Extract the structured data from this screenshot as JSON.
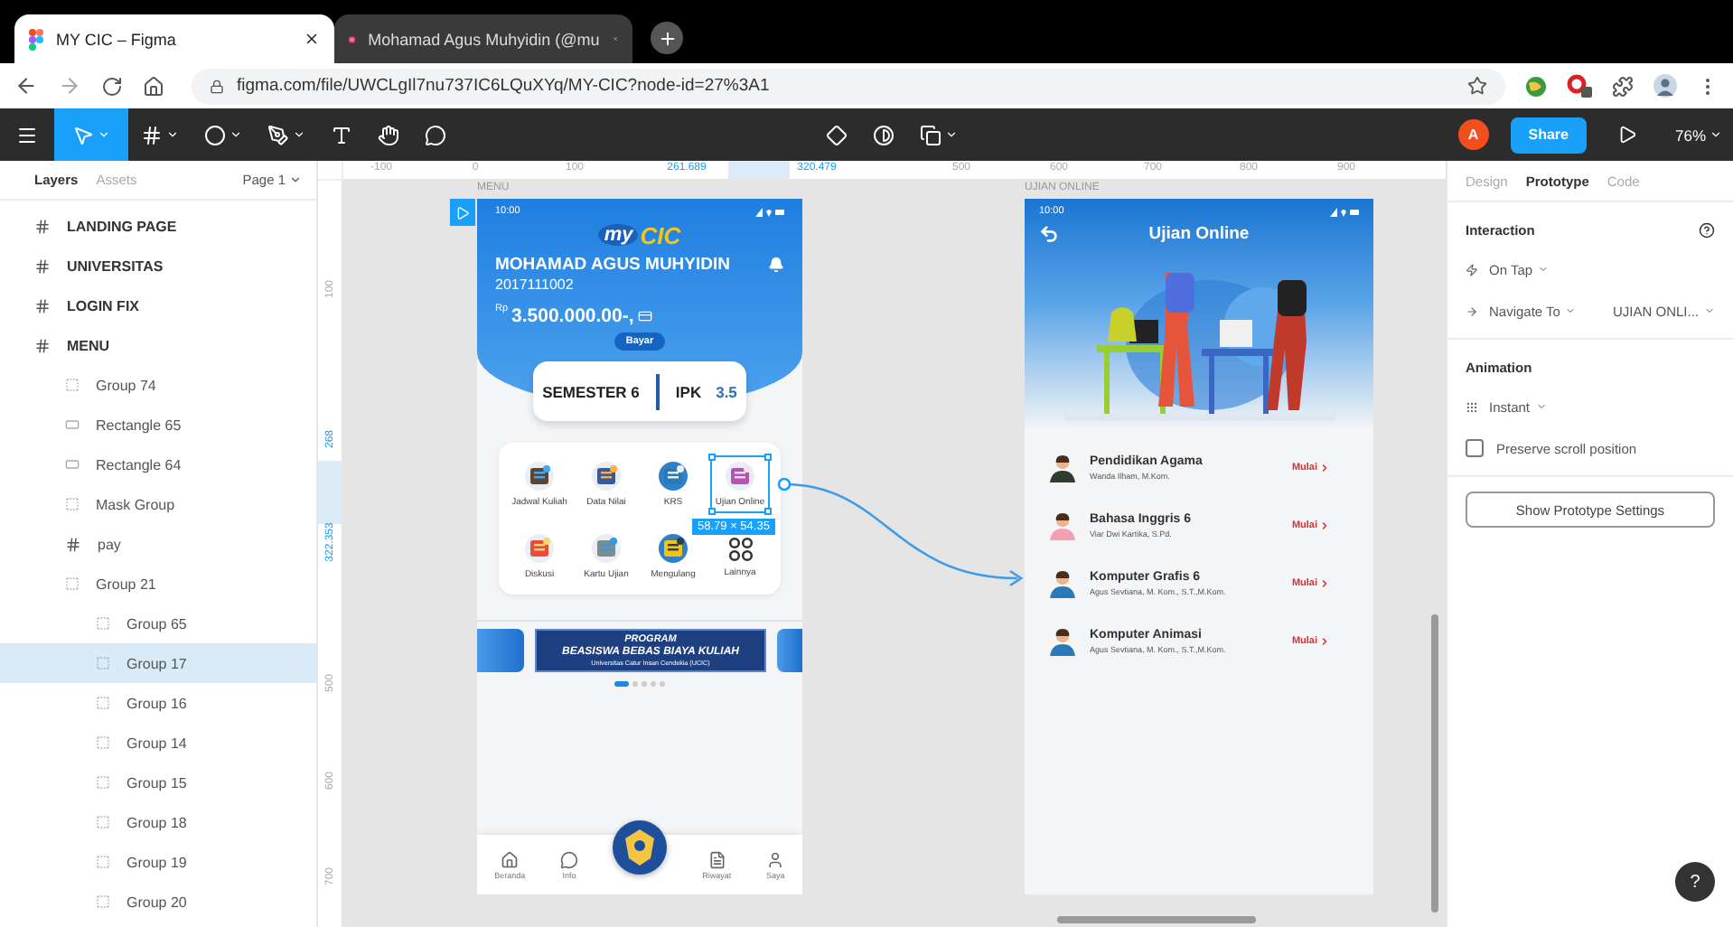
{
  "browser": {
    "tabs": [
      {
        "title": "MY CIC – Figma",
        "selected": true
      },
      {
        "title": "Mohamad Agus Muhyidin (@mu",
        "selected": false
      }
    ],
    "url": "figma.com/file/UWCLgIl7nu737IC6LQuXYq/MY-CIC?node-id=27%3A1"
  },
  "toolbar": {
    "tools": [
      {
        "kind": "move",
        "selected": true
      },
      {
        "kind": "frame",
        "selected": false
      },
      {
        "kind": "shape",
        "selected": false
      },
      {
        "kind": "pen",
        "selected": false
      },
      {
        "kind": "text",
        "selected": false
      },
      {
        "kind": "hand",
        "selected": false
      },
      {
        "kind": "comment",
        "selected": false
      }
    ],
    "avatar": "A",
    "share": "Share",
    "zoom": "76%"
  },
  "layers_panel": {
    "tabs": [
      {
        "label": "Layers",
        "selected": true
      },
      {
        "label": "Assets",
        "selected": false
      }
    ],
    "page": "Page 1",
    "layers": [
      {
        "name": "LANDING PAGE",
        "kind": "frame",
        "selected": false
      },
      {
        "name": "UNIVERSITAS",
        "kind": "frame",
        "selected": false
      },
      {
        "name": "LOGIN FIX",
        "kind": "frame",
        "selected": false
      },
      {
        "name": "MENU",
        "kind": "frame",
        "selected": false,
        "children": [
          {
            "name": "Group 74",
            "kind": "group",
            "selected": false
          },
          {
            "name": "Rectangle 65",
            "kind": "rectangle",
            "selected": false
          },
          {
            "name": "Rectangle 64",
            "kind": "rectangle",
            "selected": false
          },
          {
            "name": "Mask Group",
            "kind": "group",
            "selected": false
          },
          {
            "name": "pay",
            "kind": "frame",
            "selected": false
          },
          {
            "name": "Group 21",
            "kind": "group",
            "selected": false,
            "children": [
              {
                "name": "Group 65",
                "kind": "group",
                "selected": false
              },
              {
                "name": "Group 17",
                "kind": "group",
                "selected": true
              },
              {
                "name": "Group 16",
                "kind": "group",
                "selected": false
              },
              {
                "name": "Group 14",
                "kind": "group",
                "selected": false
              },
              {
                "name": "Group 15",
                "kind": "group",
                "selected": false
              },
              {
                "name": "Group 18",
                "kind": "group",
                "selected": false
              },
              {
                "name": "Group 19",
                "kind": "group",
                "selected": false
              },
              {
                "name": "Group 20",
                "kind": "group",
                "selected": false
              }
            ]
          }
        ]
      }
    ]
  },
  "canvas": {
    "top_ruler": [
      {
        "label": "-100",
        "highlighted": false
      },
      {
        "label": "0",
        "highlighted": false
      },
      {
        "label": "100",
        "highlighted": false
      },
      {
        "label": "261.689",
        "highlighted": true
      },
      {
        "label": "320.479",
        "highlighted": true
      },
      {
        "label": "500",
        "highlighted": false
      },
      {
        "label": "600",
        "highlighted": false
      },
      {
        "label": "700",
        "highlighted": false
      },
      {
        "label": "800",
        "highlighted": false
      },
      {
        "label": "900",
        "highlighted": false
      }
    ],
    "left_ruler": [
      {
        "label": "100",
        "highlighted": false
      },
      {
        "label": "268",
        "highlighted": true
      },
      {
        "label": "322.353",
        "highlighted": true
      },
      {
        "label": "500",
        "highlighted": false
      },
      {
        "label": "600",
        "highlighted": false
      },
      {
        "label": "700",
        "highlighted": false
      }
    ],
    "frame_labels": [
      "MENU",
      "UJIAN ONLINE"
    ],
    "selection_size": "58.79 × 54.35"
  },
  "menu_screen": {
    "time": "10:00",
    "logo_prefix": "my",
    "logo": "CIC",
    "name": "MOHAMAD AGUS MUHYIDIN",
    "student_id": "2017111002",
    "currency": "Rp",
    "balance": "3.500.000.00-,",
    "pay_button": "Bayar",
    "semester": "SEMESTER 6",
    "gpa_label": "IPK",
    "gpa": "3.5",
    "menu_items": [
      {
        "label": "Jadwal Kuliah",
        "selected": false
      },
      {
        "label": "Data Nilai",
        "selected": false
      },
      {
        "label": "KRS",
        "selected": false
      },
      {
        "label": "Ujian Online",
        "selected": true
      },
      {
        "label": "Diskusi",
        "selected": false
      },
      {
        "label": "Kartu Ujian",
        "selected": false
      },
      {
        "label": "Mengulang",
        "selected": false
      },
      {
        "label": "Lainnya",
        "selected": false
      }
    ],
    "banner": {
      "eyebrow": "PROGRAM",
      "title": "BEASISWA BEBAS BIAYA KULIAH",
      "subtitle": "Universitas Catur Insan Cendekia (UCIC)"
    },
    "carousel_dots": [
      {
        "selected": true
      },
      {
        "selected": false
      },
      {
        "selected": false
      },
      {
        "selected": false
      },
      {
        "selected": false
      }
    ],
    "nav": [
      {
        "label": "Beranda"
      },
      {
        "label": "Info"
      },
      {
        "label": "Riwayat"
      },
      {
        "label": "Saya"
      }
    ]
  },
  "exam_screen": {
    "time": "10:00",
    "title": "Ujian Online",
    "exams": [
      {
        "course": "Pendidikan Agama",
        "lecturer": "Wanda Ilham, M.Kom.",
        "action": "Mulai"
      },
      {
        "course": "Bahasa Inggris 6",
        "lecturer": "Viar Dwi Kartika, S.Pd.",
        "action": "Mulai"
      },
      {
        "course": "Komputer Grafis 6",
        "lecturer": "Agus Sevtiana, M. Kom., S.T.,M.Kom.",
        "action": "Mulai"
      },
      {
        "course": "Komputer Animasi",
        "lecturer": "Agus Sevtiana, M. Kom., S.T.,M.Kom.",
        "action": "Mulai"
      }
    ]
  },
  "prototype_panel": {
    "tabs": [
      {
        "label": "Design",
        "selected": false
      },
      {
        "label": "Prototype",
        "selected": true
      },
      {
        "label": "Code",
        "selected": false
      }
    ],
    "interaction_heading": "Interaction",
    "trigger": "On Tap",
    "action": "Navigate To",
    "destination": "UJIAN ONLI...",
    "animation_heading": "Animation",
    "animation": "Instant",
    "preserve_scroll": {
      "label": "Preserve scroll position",
      "checked": false
    },
    "settings_button": "Show Prototype Settings"
  },
  "help_button": "?"
}
